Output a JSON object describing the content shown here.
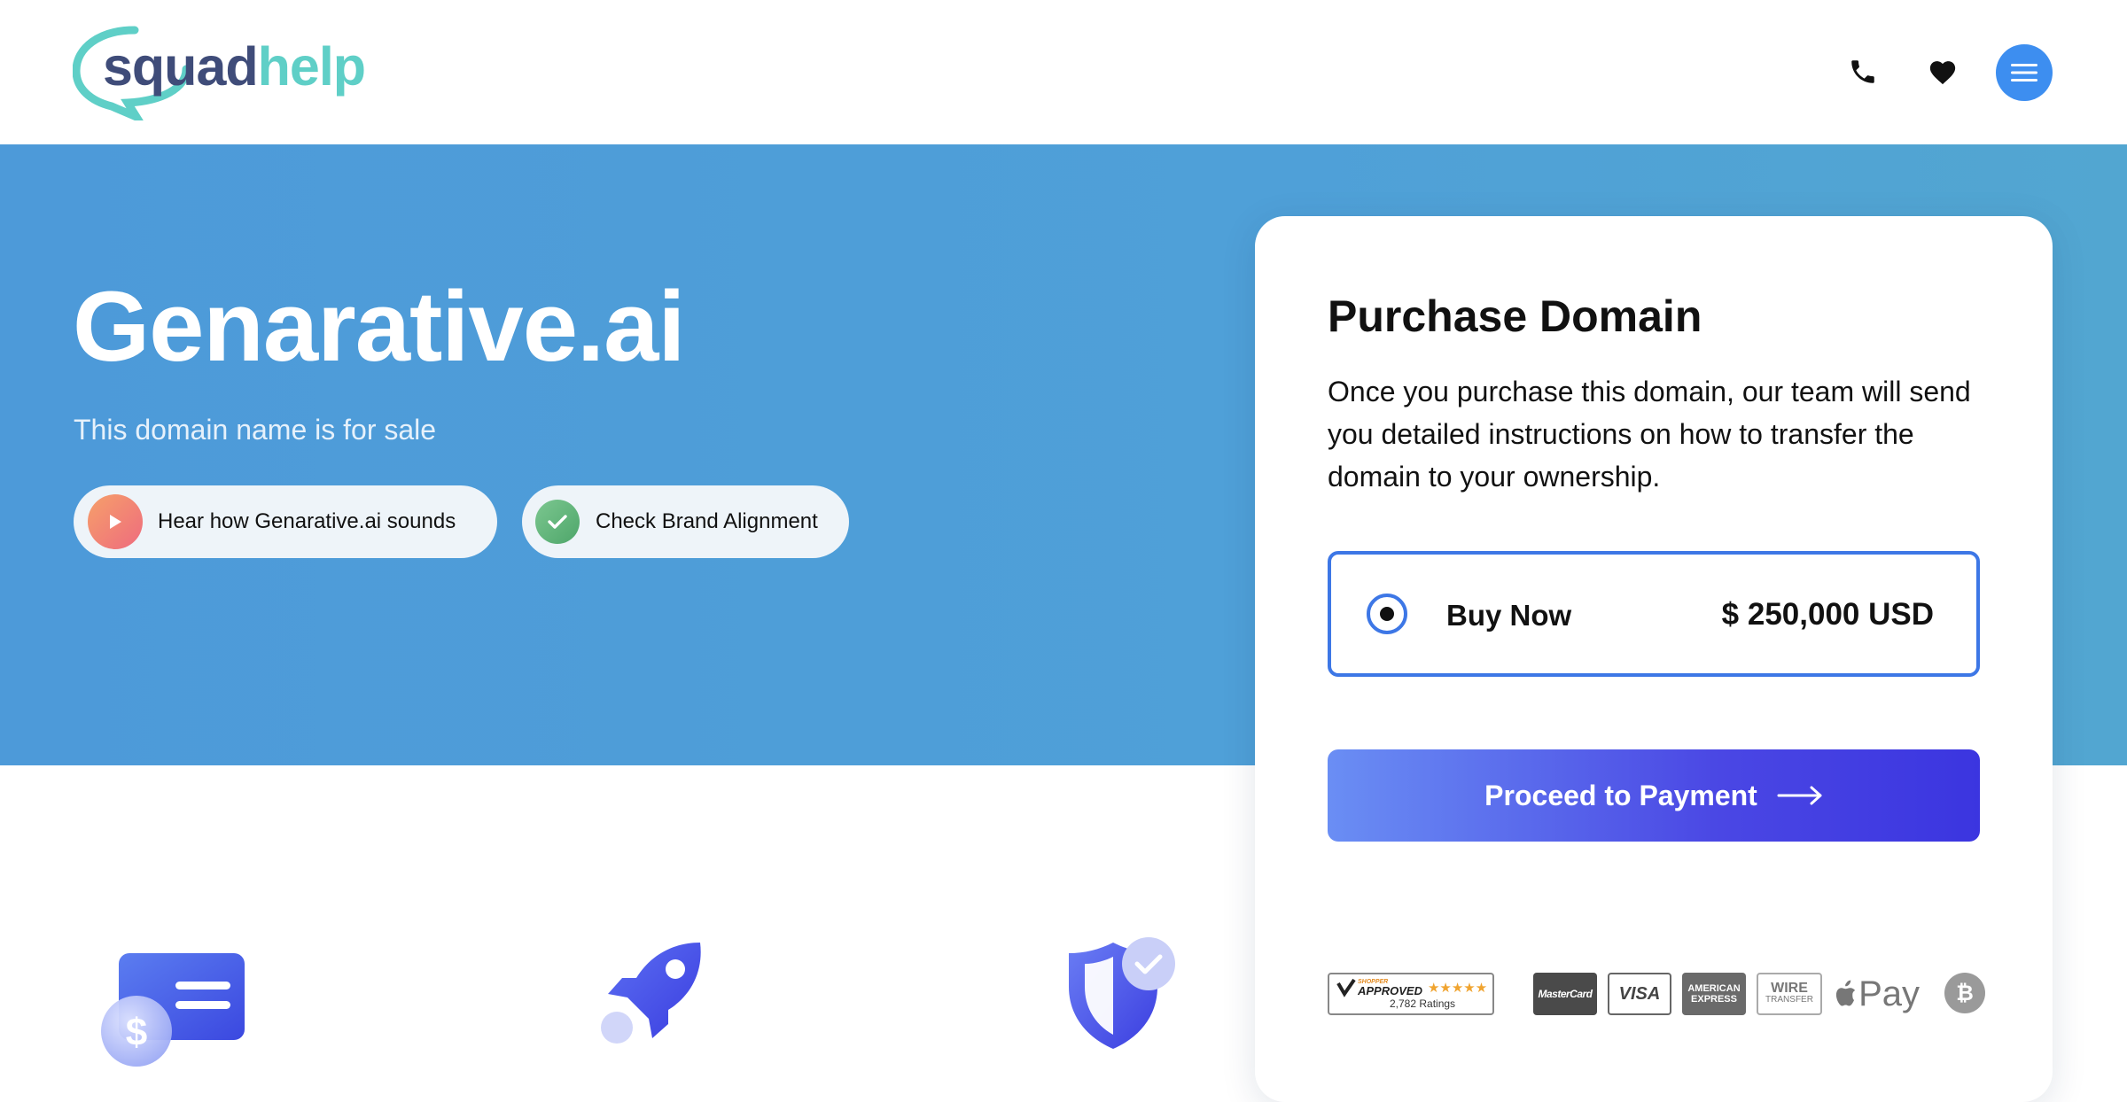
{
  "header": {
    "logo_part1": "squad",
    "logo_part2": "help",
    "phone_icon": "phone-icon",
    "heart_icon": "heart-icon",
    "menu_icon": "hamburger-menu-icon",
    "accent_color": "#3d8ef0"
  },
  "hero": {
    "title": "Genarative.ai",
    "subtitle": "This domain name is for sale",
    "listen_button": "Hear how Genarative.ai sounds",
    "brand_button": "Check Brand Alignment",
    "background_color": "#4f9fd8"
  },
  "purchase": {
    "title": "Purchase Domain",
    "description": "Once you purchase this domain, our team will send you detailed instructions on how to transfer the domain to your ownership.",
    "option_label": "Buy Now",
    "option_price": "$ 250,000 USD",
    "option_selected": true,
    "cta_label": "Proceed to Payment",
    "badges": {
      "shopper_approved": "APPROVED",
      "shopper_brand": "SHOPPER",
      "shopper_stars": "★★★★★",
      "shopper_ratings": "2,782 Ratings",
      "mastercard": "MasterCard",
      "visa": "VISA",
      "amex_line1": "AMERICAN",
      "amex_line2": "EXPRESS",
      "wire_line1": "WIRE",
      "wire_line2": "TRANSFER",
      "applepay": "Pay",
      "bitcoin_icon": "bitcoin-icon"
    }
  },
  "features": {
    "icons": [
      "payment-card-icon",
      "rocket-icon",
      "shield-check-icon"
    ]
  }
}
